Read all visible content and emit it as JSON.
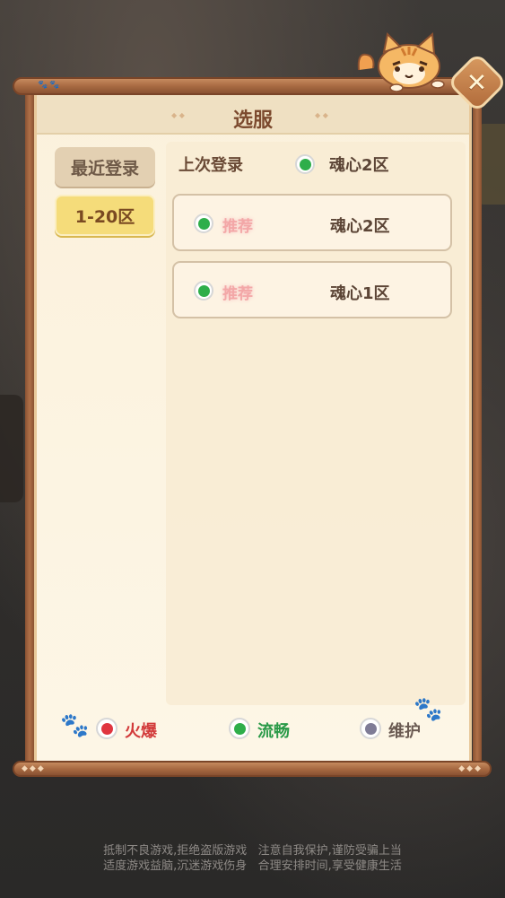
{
  "dialog": {
    "title": "选服",
    "close_icon": "close-icon"
  },
  "tabs": [
    {
      "label": "最近登录",
      "selected": false
    },
    {
      "label": "1-20区",
      "selected": true
    }
  ],
  "last_login": {
    "label": "上次登录",
    "server_name": "魂心2区",
    "status_color": "#2eae4a"
  },
  "servers": [
    {
      "tag": "推荐",
      "name": "魂心2区",
      "status_color": "#2eae4a"
    },
    {
      "tag": "推荐",
      "name": "魂心1区",
      "status_color": "#2eae4a"
    }
  ],
  "legend": [
    {
      "label": "火爆",
      "color": "#e0353f",
      "text_color": "#d23a3a"
    },
    {
      "label": "流畅",
      "color": "#2eae4a",
      "text_color": "#2a9a48"
    },
    {
      "label": "维护",
      "color": "#7f7c96",
      "text_color": "#6a5a52"
    }
  ],
  "notice": {
    "line1": "抵制不良游戏,拒绝盗版游戏   注意自我保护,谨防受骗上当",
    "line2": "适度游戏益脑,沉迷游戏伤身   合理安排时间,享受健康生活"
  }
}
